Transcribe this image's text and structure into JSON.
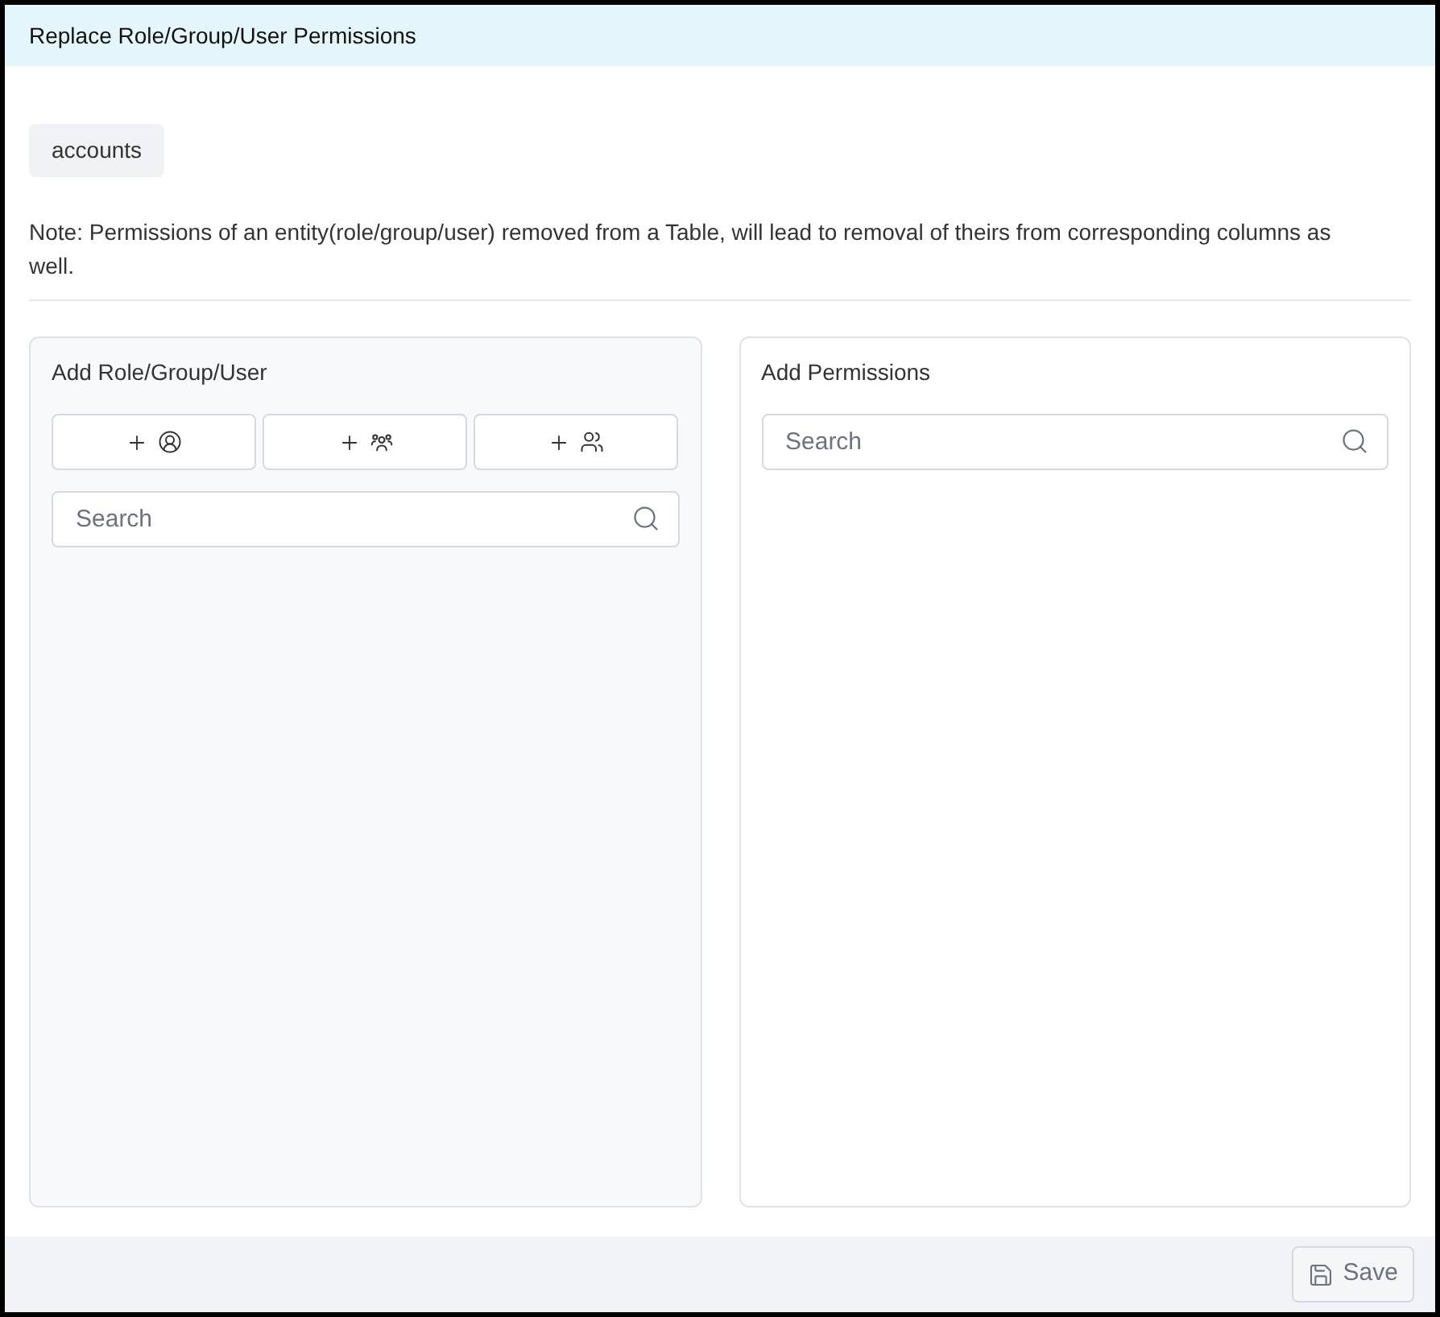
{
  "window": {
    "title": "Replace Role/Group/User Permissions"
  },
  "table_chip": "accounts",
  "note": "Note: Permissions of an entity(role/group/user) removed from a Table, will lead to removal of theirs from corresponding columns as well.",
  "left_panel": {
    "title": "Add Role/Group/User",
    "add_buttons": [
      {
        "kind": "role"
      },
      {
        "kind": "group"
      },
      {
        "kind": "user"
      }
    ],
    "search": {
      "placeholder": "Search"
    }
  },
  "right_panel": {
    "title": "Add Permissions",
    "search": {
      "placeholder": "Search"
    }
  },
  "footer": {
    "save": {
      "label": "Save",
      "disabled": true
    }
  }
}
